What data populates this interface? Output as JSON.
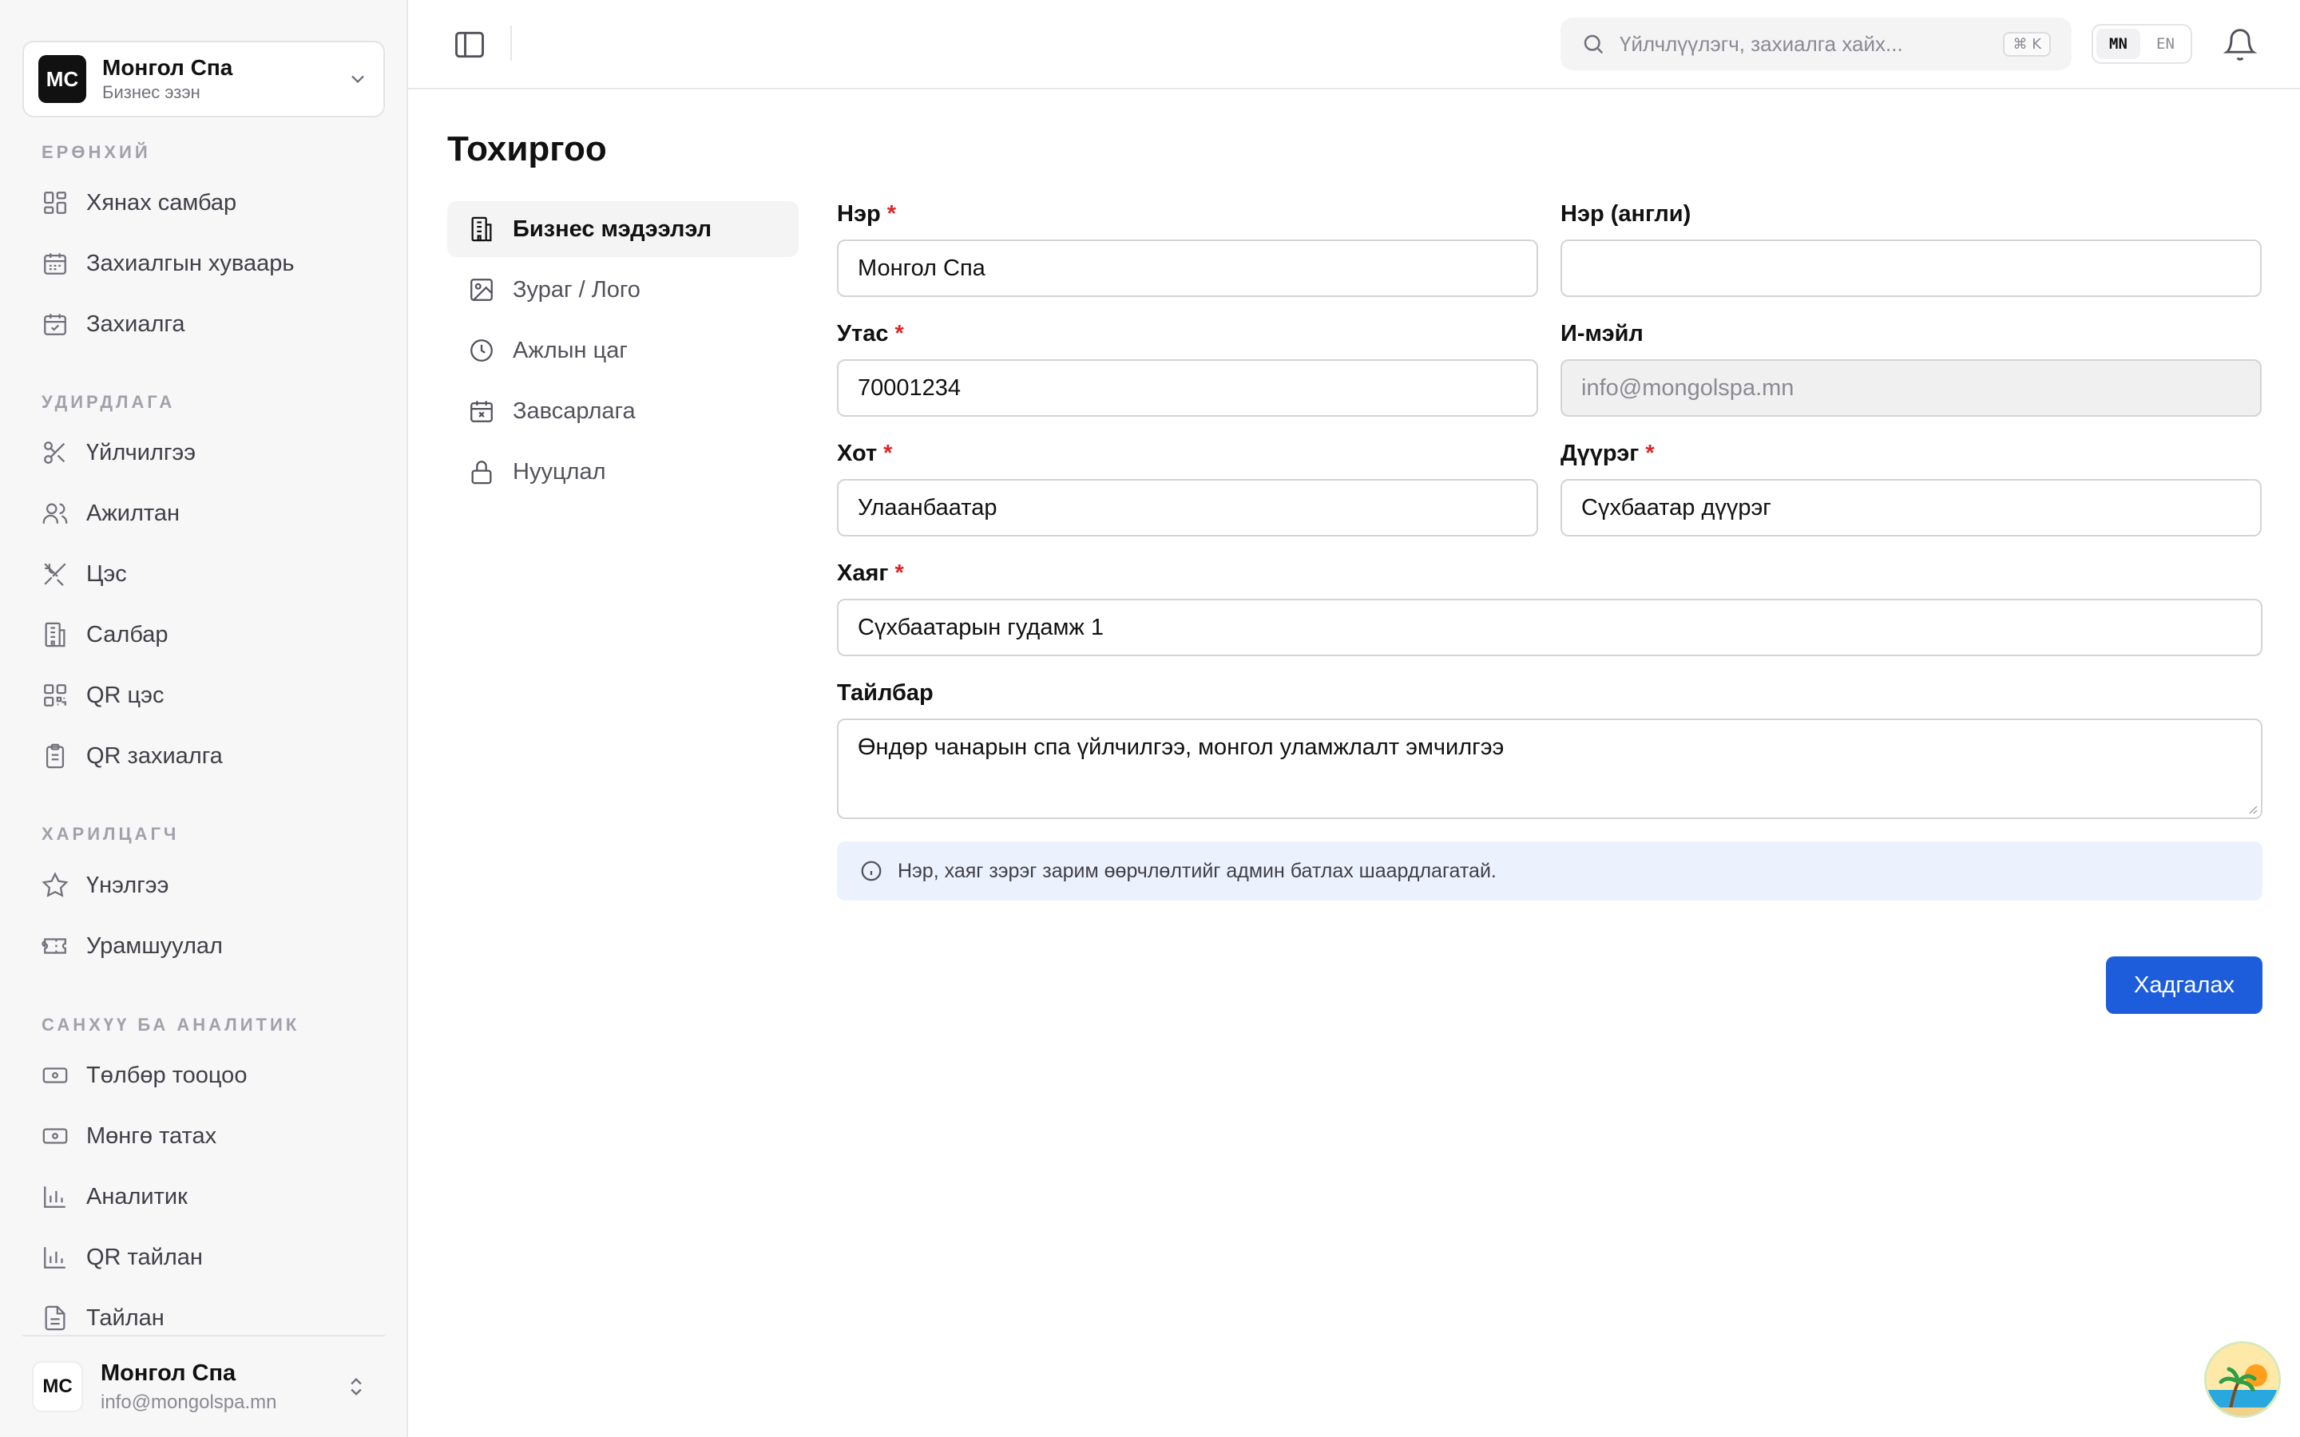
{
  "sidebar": {
    "business": {
      "initials": "MC",
      "name": "Монгол Спа",
      "role": "Бизнес эзэн"
    },
    "sections": [
      {
        "title": "ЕРӨНХИЙ",
        "items": [
          {
            "label": "Хянах самбар",
            "icon": "dashboard-icon"
          },
          {
            "label": "Захиалгын хуваарь",
            "icon": "calendar-icon"
          },
          {
            "label": "Захиалга",
            "icon": "calendar-check-icon"
          }
        ]
      },
      {
        "title": "УДИРДЛАГА",
        "items": [
          {
            "label": "Үйлчилгээ",
            "icon": "scissors-icon"
          },
          {
            "label": "Ажилтан",
            "icon": "users-icon"
          },
          {
            "label": "Цэс",
            "icon": "utensils-icon"
          },
          {
            "label": "Салбар",
            "icon": "building-icon"
          },
          {
            "label": "QR цэс",
            "icon": "qr-icon"
          },
          {
            "label": "QR захиалга",
            "icon": "clipboard-icon"
          }
        ]
      },
      {
        "title": "ХАРИЛЦАГЧ",
        "items": [
          {
            "label": "Үнэлгээ",
            "icon": "star-icon"
          },
          {
            "label": "Урамшуулал",
            "icon": "ticket-icon"
          }
        ]
      },
      {
        "title": "САНХҮҮ БА АНАЛИТИК",
        "items": [
          {
            "label": "Төлбөр тооцоо",
            "icon": "banknote-icon"
          },
          {
            "label": "Мөнгө татах",
            "icon": "banknote-icon"
          },
          {
            "label": "Аналитик",
            "icon": "bar-chart-icon"
          },
          {
            "label": "QR тайлан",
            "icon": "bar-chart-icon"
          },
          {
            "label": "Тайлан",
            "icon": "file-icon"
          }
        ]
      }
    ],
    "user": {
      "initials": "MC",
      "name": "Монгол Спа",
      "email": "info@mongolspa.mn"
    }
  },
  "topbar": {
    "search_placeholder": "Үйлчлүүлэгч, захиалга хайх...",
    "shortcut": "⌘ K",
    "lang_active": "MN",
    "lang_other": "EN"
  },
  "page": {
    "title": "Тохиргоо"
  },
  "settings_nav": [
    {
      "label": "Бизнес мэдээлэл",
      "icon": "building-icon",
      "active": true
    },
    {
      "label": "Зураг / Лого",
      "icon": "image-icon",
      "active": false
    },
    {
      "label": "Ажлын цаг",
      "icon": "clock-icon",
      "active": false
    },
    {
      "label": "Завсарлага",
      "icon": "calendar-x-icon",
      "active": false
    },
    {
      "label": "Нууцлал",
      "icon": "lock-icon",
      "active": false
    }
  ],
  "form": {
    "name": {
      "label": "Нэр",
      "value": "Монгол Спа",
      "required": true
    },
    "name_en": {
      "label": "Нэр (англи)",
      "value": ""
    },
    "phone": {
      "label": "Утас",
      "value": "70001234",
      "required": true
    },
    "email": {
      "label": "И-мэйл",
      "value": "info@mongolspa.mn",
      "disabled": true
    },
    "city": {
      "label": "Хот",
      "value": "Улаанбаатар",
      "required": true
    },
    "district": {
      "label": "Дүүрэг",
      "value": "Сүхбаатар дүүрэг",
      "required": true
    },
    "address": {
      "label": "Хаяг",
      "value": "Сүхбаатарын гудамж 1",
      "required": true
    },
    "description": {
      "label": "Тайлбар",
      "value": "Өндөр чанарын спа үйлчилгээ, монгол уламжлалт эмчилгээ"
    },
    "required_mark": "*"
  },
  "info_text": "Нэр, хаяг зэрэг зарим өөрчлөлтийг админ батлах шаардлагатай.",
  "save_label": "Хадгалах"
}
